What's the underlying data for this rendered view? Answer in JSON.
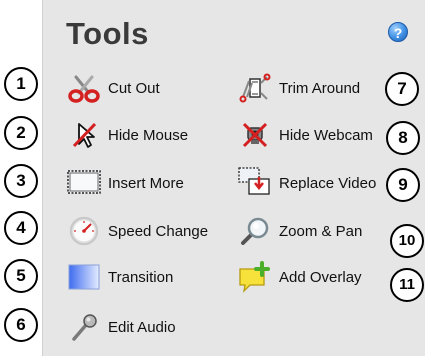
{
  "panel": {
    "title": "Tools",
    "help_icon": "help-icon",
    "help_glyph": "?"
  },
  "tools_left": [
    {
      "label": "Cut Out",
      "icon": "scissors-icon",
      "badge": "1"
    },
    {
      "label": "Hide Mouse",
      "icon": "hide-mouse-icon",
      "badge": "2"
    },
    {
      "label": "Insert More",
      "icon": "insert-more-icon",
      "badge": "3"
    },
    {
      "label": "Speed Change",
      "icon": "speed-gauge-icon",
      "badge": "4"
    },
    {
      "label": "Transition",
      "icon": "transition-icon",
      "badge": "5"
    },
    {
      "label": "Edit Audio",
      "icon": "microphone-icon",
      "badge": "6"
    }
  ],
  "tools_right": [
    {
      "label": "Trim Around",
      "icon": "trim-icon",
      "badge": "7"
    },
    {
      "label": "Hide Webcam",
      "icon": "hide-webcam-icon",
      "badge": "8"
    },
    {
      "label": "Replace Video",
      "icon": "replace-video-icon",
      "badge": "9"
    },
    {
      "label": "Zoom & Pan",
      "icon": "magnifier-icon",
      "badge": "10"
    },
    {
      "label": "Add Overlay",
      "icon": "add-overlay-icon",
      "badge": "11"
    }
  ]
}
